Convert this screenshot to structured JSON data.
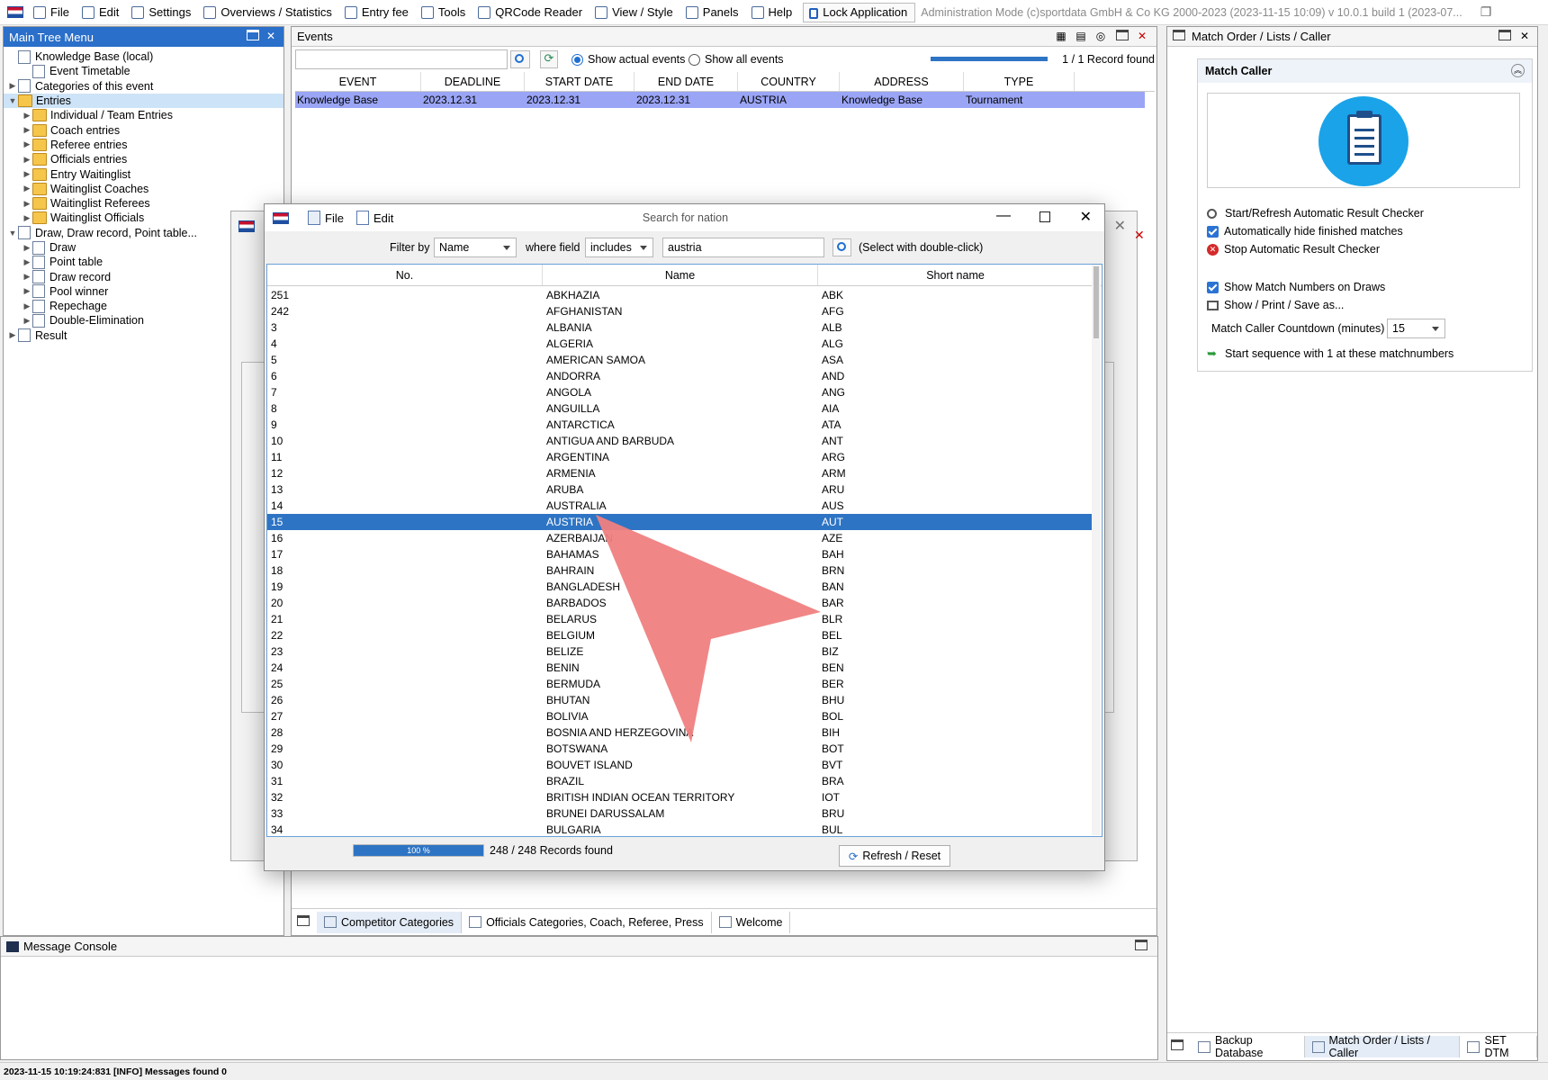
{
  "menubar": {
    "items": [
      "File",
      "Edit",
      "Settings",
      "Overviews / Statistics",
      "Entry fee",
      "Tools",
      "QRCode Reader",
      "View / Style",
      "Panels",
      "Help"
    ],
    "lock": "Lock Application",
    "title": "Administration Mode (c)sportdata GmbH & Co KG 2000-2023 (2023-11-15 10:09)  v 10.0.1 build 1 (2023-07..."
  },
  "tree": {
    "title": "Main Tree Menu",
    "items": [
      {
        "label": "Knowledge Base (local)",
        "level": 0,
        "arrow": "",
        "icon": "doc"
      },
      {
        "label": "Event Timetable",
        "level": 1,
        "arrow": "",
        "icon": "clock"
      },
      {
        "label": "Categories of this event",
        "level": 0,
        "arrow": "▶",
        "icon": "doc"
      },
      {
        "label": "Entries",
        "level": 0,
        "arrow": "▼",
        "icon": "folder"
      },
      {
        "label": "Individual / Team Entries",
        "level": 1,
        "arrow": "▶",
        "icon": "folder"
      },
      {
        "label": "Coach entries",
        "level": 1,
        "arrow": "▶",
        "icon": "folder"
      },
      {
        "label": "Referee entries",
        "level": 1,
        "arrow": "▶",
        "icon": "folder"
      },
      {
        "label": "Officials entries",
        "level": 1,
        "arrow": "▶",
        "icon": "folder"
      },
      {
        "label": "Entry Waitinglist",
        "level": 1,
        "arrow": "▶",
        "icon": "folder"
      },
      {
        "label": "Waitinglist Coaches",
        "level": 1,
        "arrow": "▶",
        "icon": "folder"
      },
      {
        "label": "Waitinglist Referees",
        "level": 1,
        "arrow": "▶",
        "icon": "folder"
      },
      {
        "label": "Waitinglist Officials",
        "level": 1,
        "arrow": "▶",
        "icon": "folder"
      },
      {
        "label": "Draw, Draw record, Point table...",
        "level": 0,
        "arrow": "▼",
        "icon": "doc"
      },
      {
        "label": "Draw",
        "level": 1,
        "arrow": "▶",
        "icon": "doc"
      },
      {
        "label": "Point table",
        "level": 1,
        "arrow": "▶",
        "icon": "doc"
      },
      {
        "label": "Draw record",
        "level": 1,
        "arrow": "▶",
        "icon": "doc"
      },
      {
        "label": "Pool winner",
        "level": 1,
        "arrow": "▶",
        "icon": "doc"
      },
      {
        "label": "Repechage",
        "level": 1,
        "arrow": "▶",
        "icon": "doc"
      },
      {
        "label": "Double-Elimination",
        "level": 1,
        "arrow": "▶",
        "icon": "doc"
      },
      {
        "label": "Result",
        "level": 0,
        "arrow": "▶",
        "icon": "doc"
      }
    ]
  },
  "events": {
    "title": "Events",
    "show_actual": "Show actual events",
    "show_all": "Show all events",
    "records": "1 / 1 Record found",
    "columns": [
      "EVENT",
      "DEADLINE",
      "START DATE",
      "END DATE",
      "COUNTRY",
      "ADDRESS",
      "TYPE"
    ],
    "row": [
      "Knowledge Base",
      "2023.12.31",
      "2023.12.31",
      "2023.12.31",
      "AUSTRIA",
      "Knowledge Base",
      "Tournament"
    ],
    "tabs": [
      "Competitor Categories",
      "Officials Categories, Coach, Referee, Press",
      "Welcome"
    ]
  },
  "console": {
    "title": "Message Console",
    "status": "2023-11-15 10:19:24:831 [INFO] Messages found 0"
  },
  "right": {
    "title": "Match Order / Lists / Caller",
    "section": "Match Caller",
    "actions": [
      "Start/Refresh Automatic Result Checker",
      "Automatically hide finished matches",
      "Stop Automatic Result Checker"
    ],
    "show_numbers": "Show Match Numbers on Draws",
    "show_print": "Show / Print / Save as...",
    "countdown_label": "Match Caller Countdown (minutes)",
    "countdown_value": "15",
    "sequence": "Start sequence with 1 at these matchnumbers",
    "bottom_tabs": [
      "Backup Database",
      "Match Order / Lists / Caller",
      "SET DTM"
    ]
  },
  "dialog": {
    "menu": [
      "File",
      "Edit"
    ],
    "title": "Search for nation",
    "filter_by": "Filter by",
    "filter_value": "Name",
    "where_field": "where field",
    "where_value": "includes",
    "search_value": "austria",
    "hint": "(Select with double-click)",
    "columns": [
      "No.",
      "Name",
      "Short name"
    ],
    "progress": "100 %",
    "progress_value": 100,
    "records": "248 / 248 Records found",
    "refresh": "Refresh / Reset",
    "selected_index": 14,
    "rows": [
      [
        "251",
        "ABKHAZIA",
        "ABK"
      ],
      [
        "242",
        "AFGHANISTAN",
        "AFG"
      ],
      [
        "3",
        "ALBANIA",
        "ALB"
      ],
      [
        "4",
        "ALGERIA",
        "ALG"
      ],
      [
        "5",
        "AMERICAN SAMOA",
        "ASA"
      ],
      [
        "6",
        "ANDORRA",
        "AND"
      ],
      [
        "7",
        "ANGOLA",
        "ANG"
      ],
      [
        "8",
        "ANGUILLA",
        "AIA"
      ],
      [
        "9",
        "ANTARCTICA",
        "ATA"
      ],
      [
        "10",
        "ANTIGUA AND BARBUDA",
        "ANT"
      ],
      [
        "11",
        "ARGENTINA",
        "ARG"
      ],
      [
        "12",
        "ARMENIA",
        "ARM"
      ],
      [
        "13",
        "ARUBA",
        "ARU"
      ],
      [
        "14",
        "AUSTRALIA",
        "AUS"
      ],
      [
        "15",
        "AUSTRIA",
        "AUT"
      ],
      [
        "16",
        "AZERBAIJAN",
        "AZE"
      ],
      [
        "17",
        "BAHAMAS",
        "BAH"
      ],
      [
        "18",
        "BAHRAIN",
        "BRN"
      ],
      [
        "19",
        "BANGLADESH",
        "BAN"
      ],
      [
        "20",
        "BARBADOS",
        "BAR"
      ],
      [
        "21",
        "BELARUS",
        "BLR"
      ],
      [
        "22",
        "BELGIUM",
        "BEL"
      ],
      [
        "23",
        "BELIZE",
        "BIZ"
      ],
      [
        "24",
        "BENIN",
        "BEN"
      ],
      [
        "25",
        "BERMUDA",
        "BER"
      ],
      [
        "26",
        "BHUTAN",
        "BHU"
      ],
      [
        "27",
        "BOLIVIA",
        "BOL"
      ],
      [
        "28",
        "BOSNIA AND HERZEGOVINA",
        "BIH"
      ],
      [
        "29",
        "BOTSWANA",
        "BOT"
      ],
      [
        "30",
        "BOUVET ISLAND",
        "BVT"
      ],
      [
        "31",
        "BRAZIL",
        "BRA"
      ],
      [
        "32",
        "BRITISH INDIAN OCEAN TERRITORY",
        "IOT"
      ],
      [
        "33",
        "BRUNEI DARUSSALAM",
        "BRU"
      ],
      [
        "34",
        "BULGARIA",
        "BUL"
      ]
    ]
  },
  "colors": {
    "accent": "#2a6fc9",
    "selection": "#2e74c4",
    "event_row": "#9aa5f5",
    "pointer": "#f08080"
  }
}
